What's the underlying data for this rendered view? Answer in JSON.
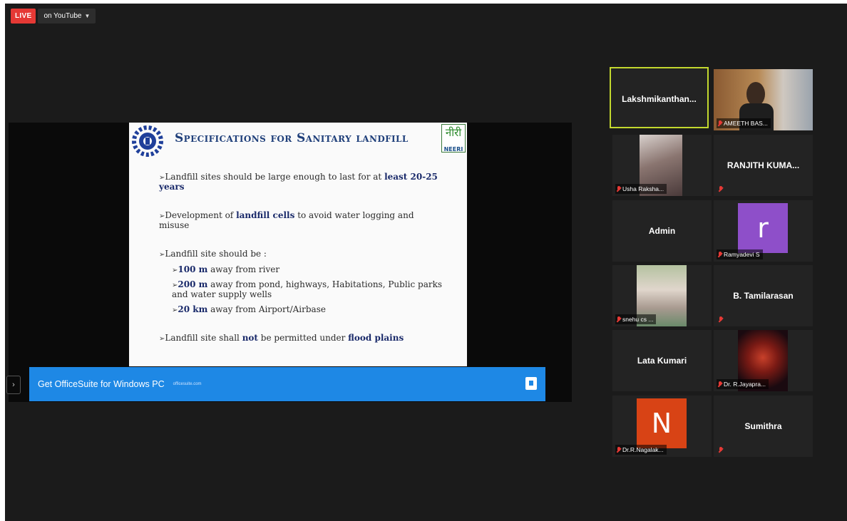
{
  "live": {
    "badge": "LIVE",
    "destination": "on YouTube"
  },
  "slide": {
    "title": "Specifications for Sanitary landfill",
    "neeri_hindi": "नीरी",
    "neeri_en": "NEERI",
    "b1_text": "Landfill sites should be large enough to last for at ",
    "b1_bold": "least 20-25 years",
    "b2_pre": "Development of ",
    "b2_bold": "landfill cells",
    "b2_post": " to avoid water logging and misuse",
    "b3_text": "Landfill site should be :",
    "s1_bold": "100 m",
    "s1_text": " away from river",
    "s2_bold": "200 m",
    "s2_text": " away from pond, highways, Habitations, Public parks and water supply wells",
    "s3_bold": "20 km",
    "s3_text": " away from Airport/Airbase",
    "b4_pre": "Landfill site shall ",
    "b4_not": "not",
    "b4_mid": " be permitted under ",
    "b4_bold": "flood plains"
  },
  "ad": {
    "text": "Get OfficeSuite for Windows PC",
    "domain": "officesuite.com"
  },
  "participants": [
    {
      "name": "Lakshmikanthan...",
      "type": "name",
      "active": true
    },
    {
      "name": "AMEETH BAS...",
      "type": "video"
    },
    {
      "name": "Usha Raksha...",
      "type": "video"
    },
    {
      "name": "RANJITH KUMA...",
      "type": "name"
    },
    {
      "name": "Admin",
      "type": "name"
    },
    {
      "name": "Ramyadevi S",
      "type": "avatar",
      "initial": "r",
      "color": "#8e4fc9"
    },
    {
      "name": "snehu cs ...",
      "type": "video"
    },
    {
      "name": "B. Tamilarasan",
      "type": "name"
    },
    {
      "name": "Lata Kumari",
      "type": "name"
    },
    {
      "name": "Dr. R.Jayapra...",
      "type": "video"
    },
    {
      "name": "Dr.R.Nagalak...",
      "type": "avatar",
      "initial": "N",
      "color": "#d84315"
    },
    {
      "name": "Sumithra",
      "type": "name"
    }
  ]
}
